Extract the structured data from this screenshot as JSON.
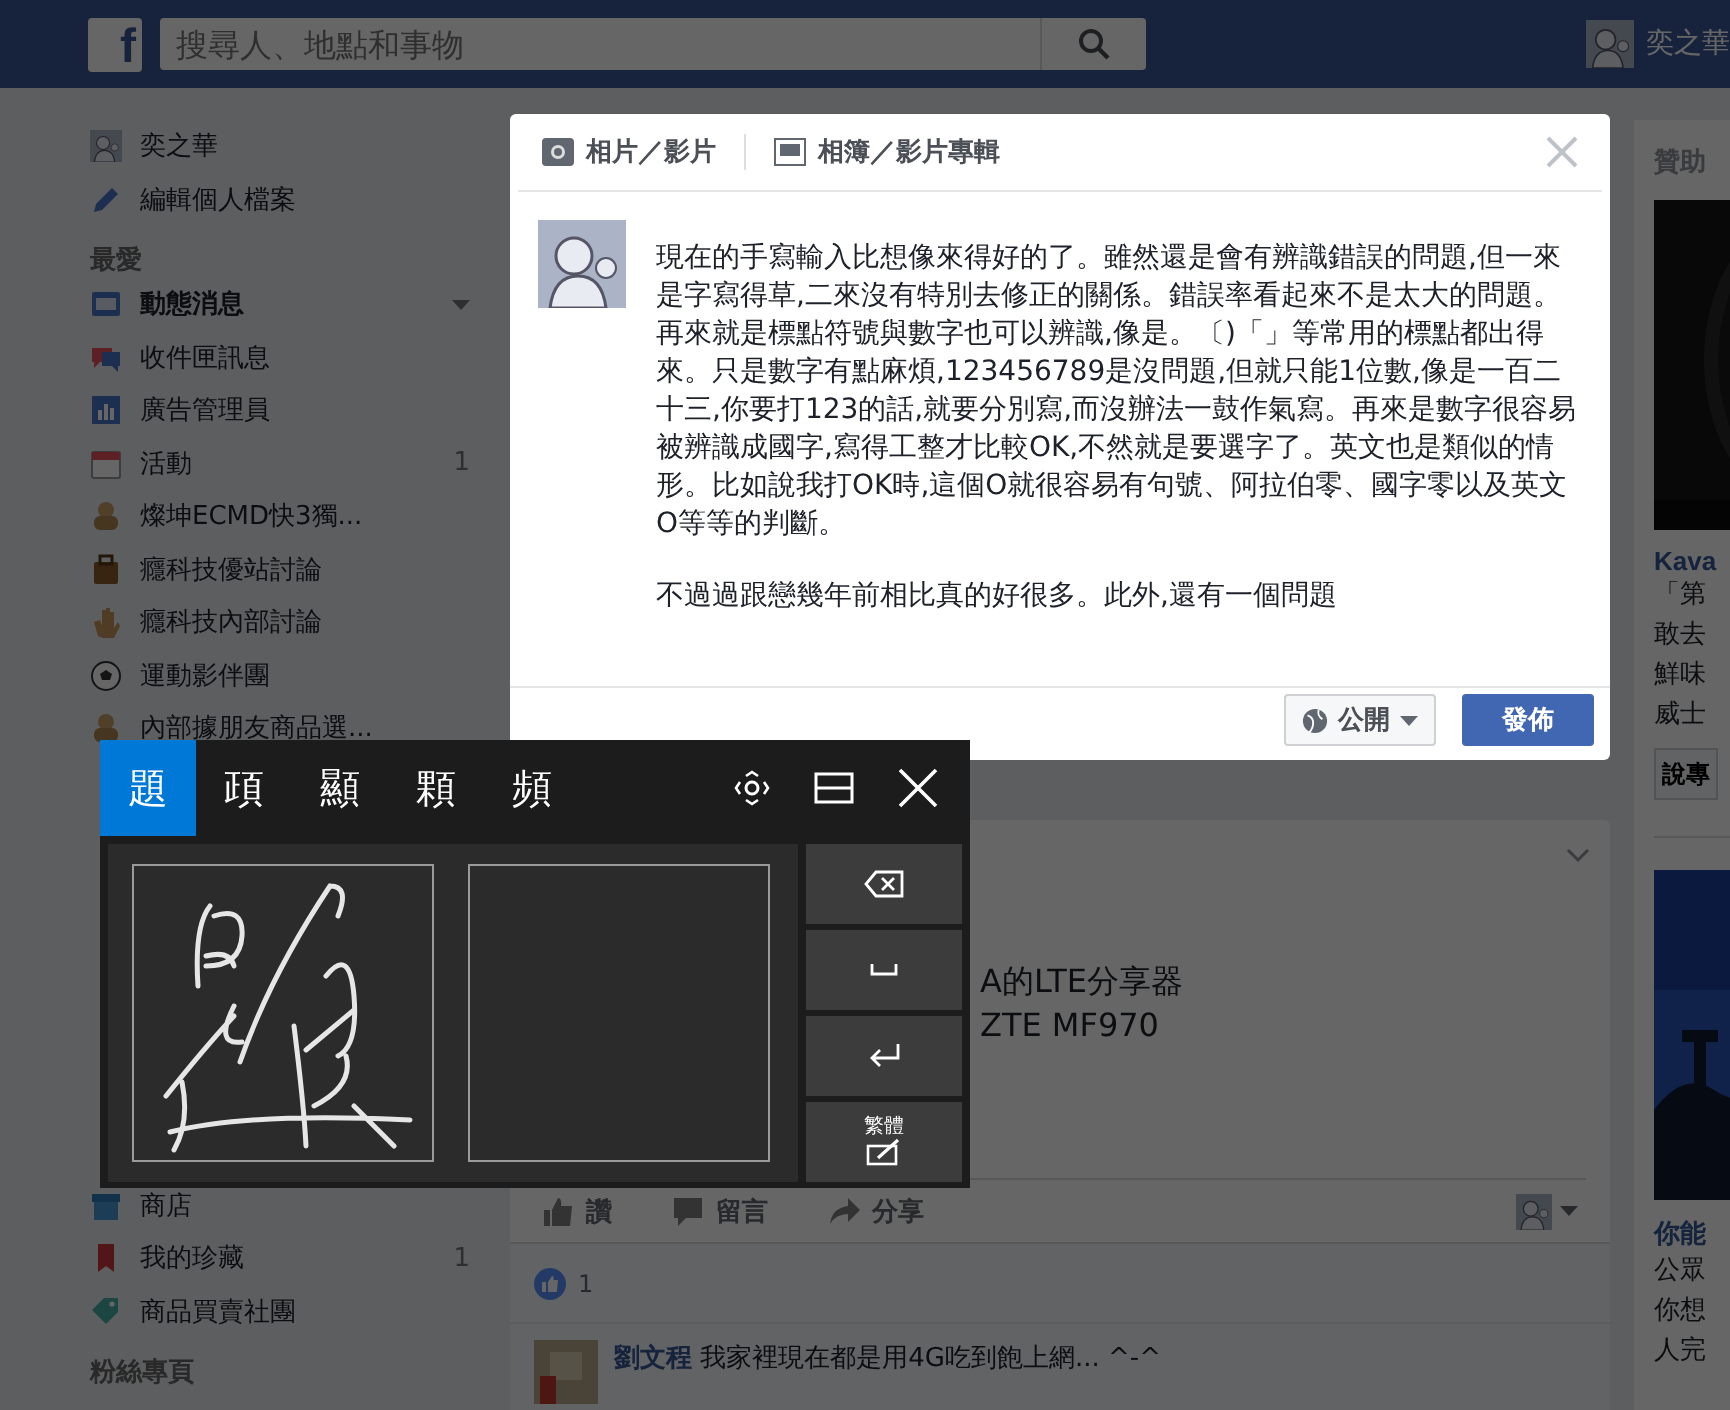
{
  "top_bar": {
    "logo": "f",
    "search": {
      "placeholder": "搜尋人、地點和事物"
    },
    "user": {
      "name": "奕之華"
    }
  },
  "sidebar": {
    "profile_items": [
      {
        "label": "奕之華"
      },
      {
        "label": "編輯個人檔案"
      }
    ],
    "sections": [
      {
        "heading": "最愛",
        "items": [
          {
            "label": "動態消息",
            "selected": true
          },
          {
            "label": "收件匣訊息",
            "selected": false
          },
          {
            "label": "廣告管理員",
            "selected": false
          },
          {
            "label": "活動",
            "selected": false,
            "count": "1"
          },
          {
            "label": "燦坤ECMD快3獨...",
            "selected": false
          },
          {
            "label": "癮科技優站討論",
            "selected": false
          },
          {
            "label": "癮科技內部討論",
            "selected": false
          },
          {
            "label": "運動影伴團",
            "selected": false
          },
          {
            "label": "內部據朋友商品選...",
            "selected": false
          }
        ]
      },
      {
        "items": [
          {
            "label": "商店",
            "selected": false
          },
          {
            "label": "我的珍藏",
            "selected": false,
            "count": "1"
          },
          {
            "label": "商品買賣社團",
            "selected": false
          }
        ]
      },
      {
        "heading": "粉絲專頁"
      }
    ]
  },
  "composer": {
    "tabs": [
      {
        "label": "相片／影片"
      },
      {
        "label": "相簿／影片專輯"
      }
    ],
    "paragraphs": [
      "現在的手寫輸入比想像來得好的了。雖然還是會有辨識錯誤的問題,但一來是字寫得草,二來沒有特別去修正的關係。錯誤率看起來不是太大的問題。再來就是標點符號與數字也可以辨識,像是。〔)「」等常用的標點都出得來。只是數字有點麻煩,123456789是沒問題,但就只能1位數,像是一百二十三,你要打123的話,就要分別寫,而沒辦法一鼓作氣寫。再來是數字很容易被辨識成國字,寫得工整才比較OK,不然就是要選字了。英文也是類似的情形。比如說我打OK時,這個O就很容易有句號、阿拉伯零、國字零以及英文O等等的判斷。",
      "不過過跟戀幾年前相比真的好很多。此外,還有一個問題"
    ],
    "audience": "公開",
    "post_button": "發佈"
  },
  "post": {
    "text_lines": [
      "A的LTE分享器",
      "ZTE MF970"
    ],
    "actions": [
      "讚",
      "留言",
      "分享"
    ],
    "like_count": "1",
    "comments": [
      {
        "author": "劉文程",
        "text": "我家裡現在都是用4G吃到飽上網... ^-^"
      }
    ]
  },
  "sponsored": {
    "heading": "贊助",
    "ads": [
      {
        "kind": "picture",
        "title": "Kava",
        "lines": [
          "「第",
          "敢去",
          "鮮味",
          "威士"
        ],
        "button": "說專"
      },
      {
        "kind": "picture",
        "title": "你能",
        "lines": [
          "公眾",
          "你想",
          "人完"
        ]
      }
    ]
  },
  "handwriting_panel": {
    "candidates": [
      {
        "char": "題",
        "selected": true
      },
      {
        "char": "頙",
        "selected": false
      },
      {
        "char": "顯",
        "selected": false
      },
      {
        "char": "顆",
        "selected": false
      },
      {
        "char": "頻",
        "selected": false
      }
    ],
    "mode_key": "繁體"
  }
}
